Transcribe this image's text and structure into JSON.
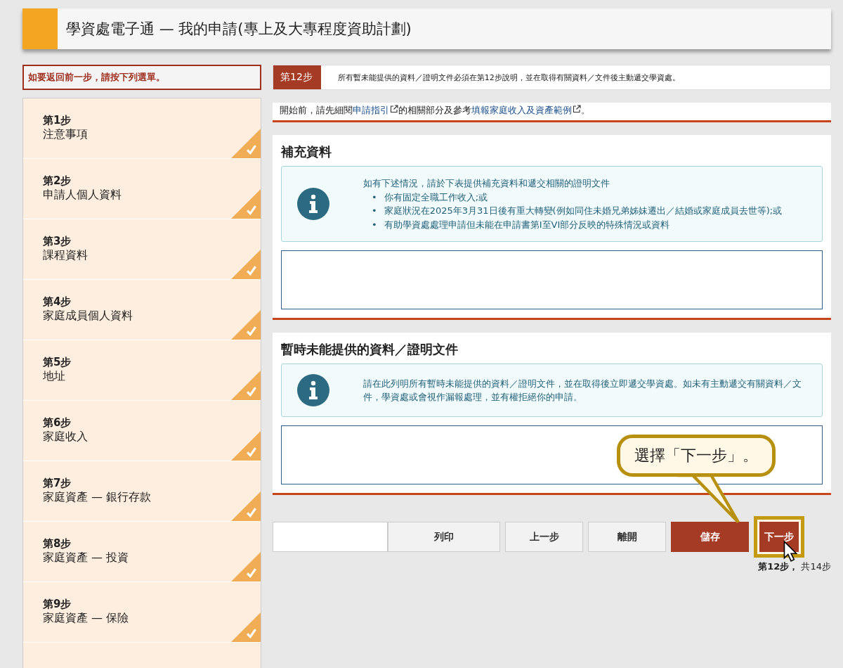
{
  "header": {
    "title": "學資處電子通 — 我的申請(專上及大專程度資助計劃)"
  },
  "back_notice": "如要返回前一步，請按下列選單。",
  "steps": [
    {
      "label": "第1步",
      "name": "注意事項",
      "completed": true
    },
    {
      "label": "第2步",
      "name": "申請人個人資料",
      "completed": true
    },
    {
      "label": "第3步",
      "name": "課程資料",
      "completed": true
    },
    {
      "label": "第4步",
      "name": "家庭成員個人資料",
      "completed": true
    },
    {
      "label": "第5步",
      "name": "地址",
      "completed": true
    },
    {
      "label": "第6步",
      "name": "家庭收入",
      "completed": true
    },
    {
      "label": "第7步",
      "name": "家庭資產 — 銀行存款",
      "completed": true
    },
    {
      "label": "第8步",
      "name": "家庭資產 — 投資",
      "completed": true
    },
    {
      "label": "第9步",
      "name": "家庭資產 — 保險",
      "completed": true
    }
  ],
  "step_banner": {
    "badge": "第12步",
    "text": "所有暫未能提供的資料／證明文件必須在第12步說明，並在取得有關資料／文件後主動遞交學資處。"
  },
  "intro": [
    {
      "kind": "text",
      "text": "開始前，請先細閱"
    },
    {
      "kind": "link",
      "text": "申請指引"
    },
    {
      "kind": "text",
      "text": "的相關部分及參考"
    },
    {
      "kind": "link",
      "text": "填報家庭收入及資產範例"
    },
    {
      "kind": "text",
      "text": "。"
    }
  ],
  "sections": [
    {
      "title": "補充資料",
      "lead": "如有下述情況，請於下表提供補充資料和遞交相關的證明文件",
      "bullets": [
        {
          "marker": "•",
          "text": "你有固定全職工作收入;或"
        },
        {
          "marker": "•",
          "text": "家庭狀況在2025年3月31日後有重大轉變(例如同住未婚兄弟姊妹遷出／結婚或家庭成員去世等);或"
        },
        {
          "marker": "•",
          "text": "有助學資處處理申請但未能在申請書第I至VI部分反映的特殊情況或資料"
        }
      ]
    },
    {
      "title": "暫時未能提供的資料／證明文件",
      "lead": "請在此列明所有暫時未能提供的資料／證明文件，並在取得後立即遞交學資處。如未有主動遞交有關資料／文件，學資處或會視作漏報處理，並有權拒絕你的申請。"
    }
  ],
  "buttons": [
    {
      "label": "列印",
      "kind": "plain",
      "highlighted": false
    },
    {
      "label": "上一步",
      "kind": "plain",
      "highlighted": false
    },
    {
      "label": "離開",
      "kind": "plain",
      "highlighted": false
    },
    {
      "label": "儲存",
      "kind": "primary",
      "highlighted": false
    },
    {
      "label": "下一步",
      "kind": "primary",
      "highlighted": true
    }
  ],
  "progress": {
    "current": "第12步，",
    "total": "共14步"
  },
  "callout": {
    "text": "選擇「下一步」。"
  }
}
